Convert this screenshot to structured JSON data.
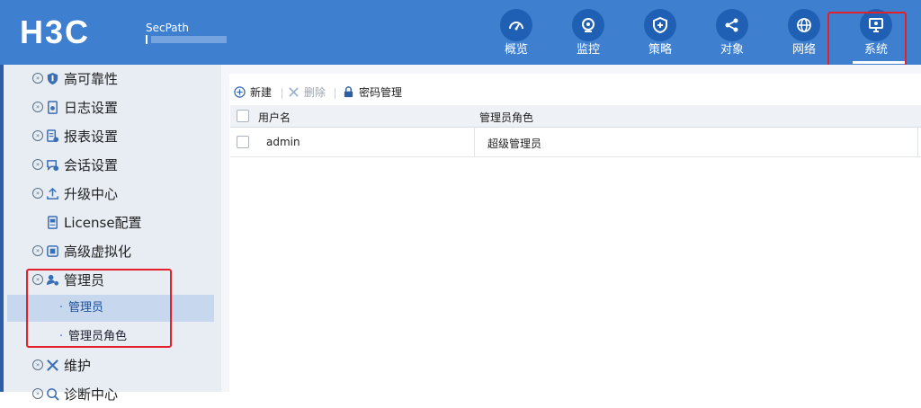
{
  "header": {
    "logo": "H3C",
    "product": "SecPath",
    "nav": [
      {
        "label": "概览",
        "icon": "gauge-icon"
      },
      {
        "label": "监控",
        "icon": "monitor-camera-icon"
      },
      {
        "label": "策略",
        "icon": "shield-plus-icon"
      },
      {
        "label": "对象",
        "icon": "share-nodes-icon"
      },
      {
        "label": "网络",
        "icon": "globe-icon"
      },
      {
        "label": "系统",
        "icon": "desktop-gear-icon",
        "active": true
      }
    ]
  },
  "sidebar": {
    "items": [
      {
        "label": "高可靠性",
        "icon": "shield-icon"
      },
      {
        "label": "日志设置",
        "icon": "document-gear-icon"
      },
      {
        "label": "报表设置",
        "icon": "report-icon"
      },
      {
        "label": "会话设置",
        "icon": "chat-gear-icon"
      },
      {
        "label": "升级中心",
        "icon": "upload-icon"
      },
      {
        "label": "License配置",
        "icon": "license-icon"
      },
      {
        "label": "高级虚拟化",
        "icon": "virtualization-icon"
      },
      {
        "label": "管理员",
        "icon": "admin-gear-icon",
        "expanded": true
      },
      {
        "label": "维护",
        "icon": "tools-icon"
      },
      {
        "label": "诊断中心",
        "icon": "diagnosis-icon"
      }
    ],
    "admin_children": [
      {
        "label": "管理员",
        "selected": true
      },
      {
        "label": "管理员角色"
      }
    ]
  },
  "toolbar": {
    "new_label": "新建",
    "delete_label": "删除",
    "password_label": "密码管理"
  },
  "grid": {
    "columns": [
      "用户名",
      "管理员角色"
    ],
    "rows": [
      {
        "username": "admin",
        "role": "超级管理员"
      }
    ]
  },
  "colors": {
    "header_bg": "#3f7fd0",
    "nav_icon_bg": "#1f5fb4",
    "highlight": "#e3212b",
    "selected_bg": "#c7d8ee"
  }
}
